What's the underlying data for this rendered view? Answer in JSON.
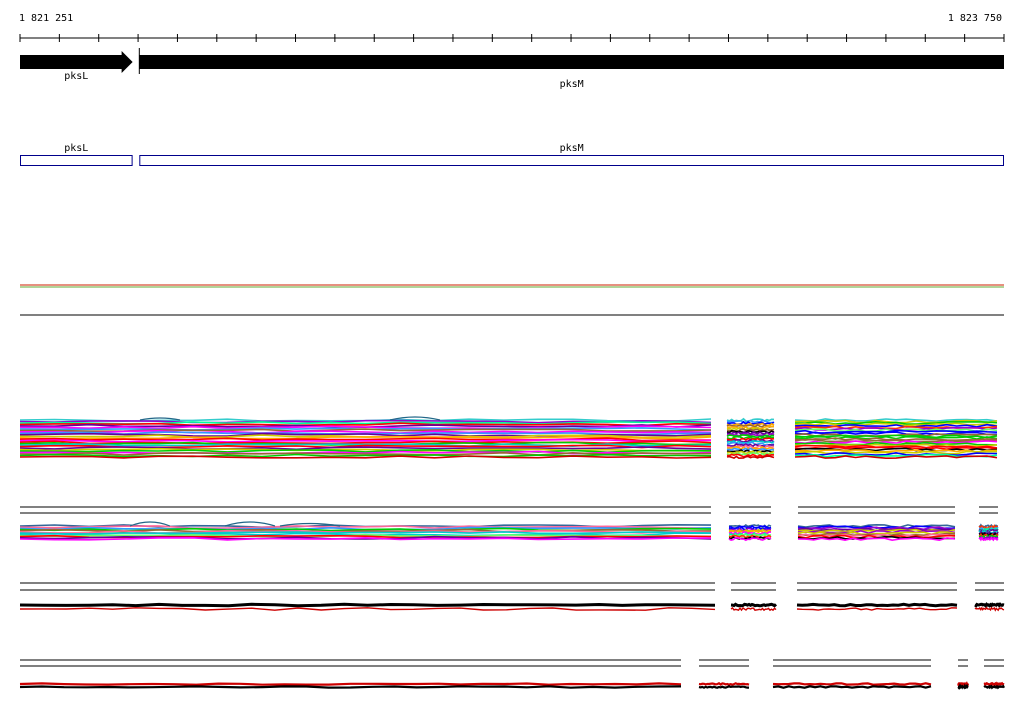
{
  "ruler": {
    "start_label": "1 821 251",
    "end_label": "1 823 750"
  },
  "genes": [
    {
      "name": "pksL",
      "start": 1821251,
      "end": 1821537,
      "strand": "+"
    },
    {
      "name": "pksM",
      "start": 1821554,
      "end": 1823750,
      "strand": "+"
    }
  ],
  "colors": {
    "gene_arrow": "#000000",
    "cds_outline": "#00008b",
    "track_line_upper": "#cc2200",
    "track_line_lower": "#66aa33"
  },
  "alignment_tracks": [
    {
      "label_visible": false
    },
    {
      "label_visible": false
    },
    {
      "label_visible": false
    },
    {
      "label_visible": false
    }
  ]
}
